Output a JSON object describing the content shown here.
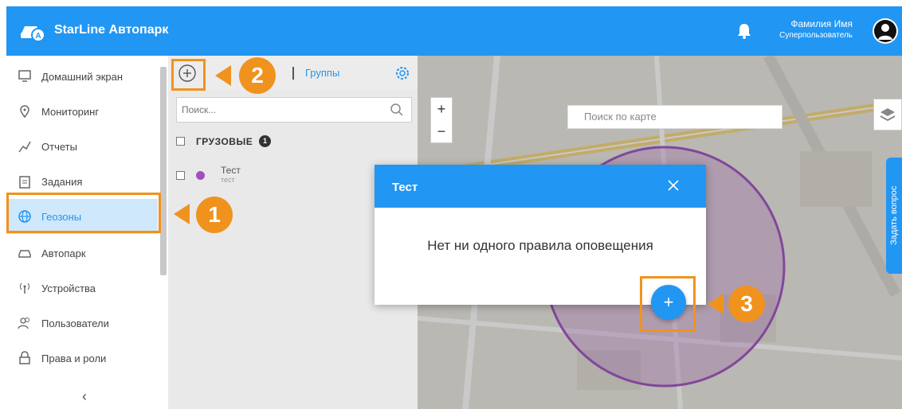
{
  "topbar": {
    "brand": "StarLine Автопарк",
    "user_name": "Фамилия Имя",
    "user_role": "Суперпользователь",
    "color": "#2196f3"
  },
  "sidebar": {
    "items": [
      {
        "label": "Домашний экран",
        "icon": "monitor-icon"
      },
      {
        "label": "Мониторинг",
        "icon": "location-pin-icon"
      },
      {
        "label": "Отчеты",
        "icon": "chart-line-icon"
      },
      {
        "label": "Задания",
        "icon": "clipboard-icon"
      },
      {
        "label": "Геозоны",
        "icon": "globe-icon",
        "active": true
      },
      {
        "label": "Автопарк",
        "icon": "car-icon"
      },
      {
        "label": "Устройства",
        "icon": "antenna-icon"
      },
      {
        "label": "Пользователи",
        "icon": "users-icon"
      },
      {
        "label": "Права и роли",
        "icon": "lock-icon"
      }
    ],
    "collapse_label": "‹"
  },
  "panel": {
    "tab_groups": "Группы",
    "search_placeholder": "Поиск...",
    "group": {
      "name": "ГРУЗОВЫЕ",
      "count": "1"
    },
    "zone": {
      "name": "Тест",
      "desc": "тест",
      "color": "#a050c0"
    }
  },
  "map": {
    "search_placeholder": "Поиск по карте",
    "ask_question": "Задать вопрос"
  },
  "modal": {
    "title": "Тест",
    "message": "Нет ни одного правила оповещения"
  },
  "fab_label": "+",
  "annotations": {
    "accent": "#f0931e",
    "callouts": [
      "1",
      "2",
      "3"
    ]
  }
}
